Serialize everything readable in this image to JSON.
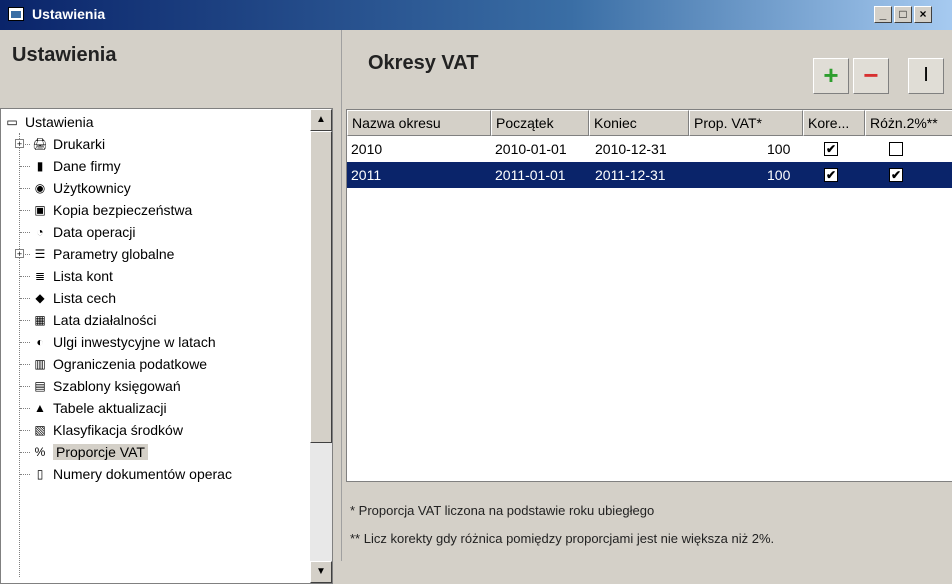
{
  "window": {
    "title": "Ustawienia",
    "buttons": {
      "minimize": "_",
      "maximize": "□",
      "close": "×"
    }
  },
  "left_panel": {
    "heading": "Ustawienia",
    "tree": {
      "root": "Ustawienia",
      "items": [
        {
          "label": "Drukarki",
          "icon": "printer-icon",
          "expandable": true
        },
        {
          "label": "Dane firmy",
          "icon": "company-data-icon",
          "expandable": false
        },
        {
          "label": "Użytkownicy",
          "icon": "users-icon",
          "expandable": false
        },
        {
          "label": "Kopia bezpieczeństwa",
          "icon": "backup-icon",
          "expandable": false
        },
        {
          "label": "Data operacji",
          "icon": "operation-date-icon",
          "expandable": false
        },
        {
          "label": "Parametry globalne",
          "icon": "global-params-icon",
          "expandable": true
        },
        {
          "label": "Lista kont",
          "icon": "accounts-list-icon",
          "expandable": false
        },
        {
          "label": "Lista cech",
          "icon": "tags-list-icon",
          "expandable": false
        },
        {
          "label": "Lata działalności",
          "icon": "calendar-years-icon",
          "expandable": false
        },
        {
          "label": "Ulgi inwestycyjne w latach",
          "icon": "investment-relief-icon",
          "expandable": false
        },
        {
          "label": "Ograniczenia podatkowe",
          "icon": "tax-limits-icon",
          "expandable": false
        },
        {
          "label": "Szablony księgowań",
          "icon": "posting-templates-icon",
          "expandable": false
        },
        {
          "label": "Tabele aktualizacji",
          "icon": "update-tables-icon",
          "expandable": false
        },
        {
          "label": "Klasyfikacja środków",
          "icon": "asset-classification-icon",
          "expandable": false
        },
        {
          "label": "Proporcje VAT",
          "icon": "vat-proportion-icon",
          "expandable": false,
          "selected": true
        },
        {
          "label": "Numery dokumentów operac",
          "icon": "document-numbers-icon",
          "expandable": false
        }
      ]
    }
  },
  "right_panel": {
    "heading": "Okresy VAT",
    "toolbar": {
      "add": "+",
      "remove": "−",
      "edit": "I"
    },
    "columns": [
      "Nazwa okresu",
      "Początek",
      "Koniec",
      "Prop. VAT*",
      "Kore...",
      "Różn.2%**"
    ],
    "rows": [
      {
        "name": "2010",
        "start": "2010-01-01",
        "end": "2010-12-31",
        "prop": "100",
        "kore": true,
        "rozn": false,
        "selected": false
      },
      {
        "name": "2011",
        "start": "2011-01-01",
        "end": "2011-12-31",
        "prop": "100",
        "kore": true,
        "rozn": true,
        "selected": true
      }
    ],
    "footnotes": [
      "* Proporcja VAT liczona na podstawie roku ubiegłego",
      "** Licz korekty gdy różnica pomiędzy proporcjami jest nie większa niż 2%."
    ]
  },
  "colors": {
    "selection": "#0a246a",
    "add_green": "#2e9e2e",
    "remove_red": "#d83030"
  }
}
